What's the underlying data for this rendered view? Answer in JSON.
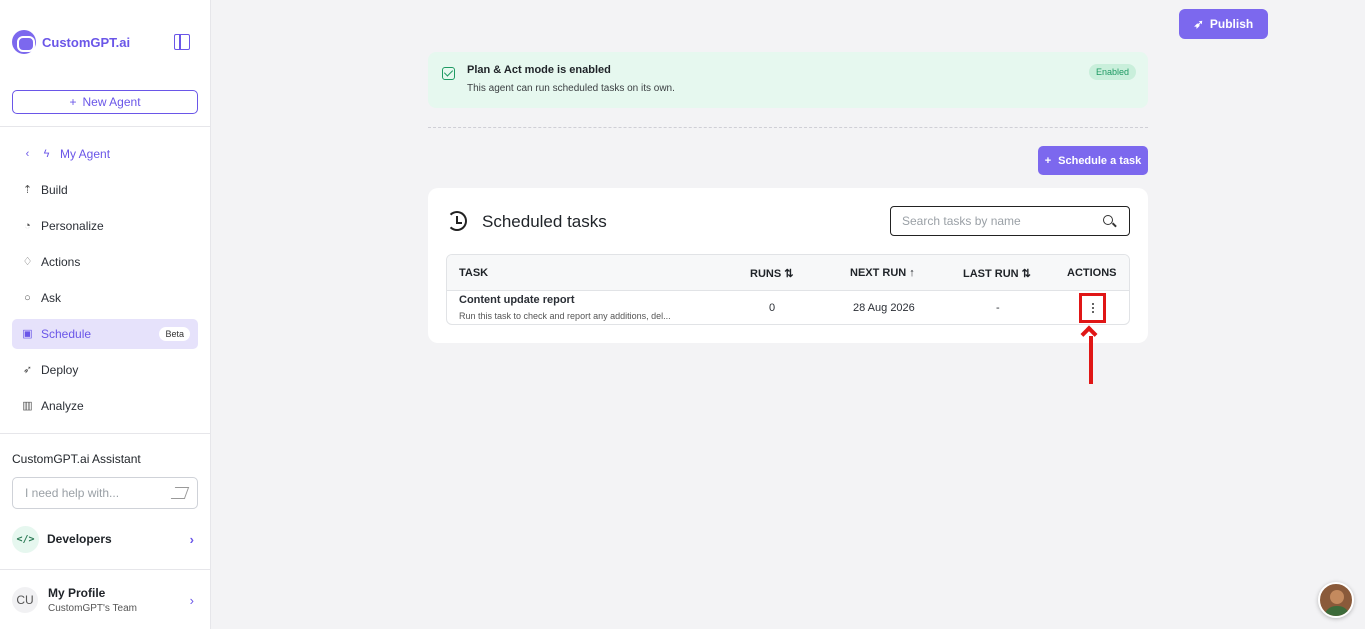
{
  "app": {
    "name": "CustomGPT.ai"
  },
  "sidebar": {
    "new_agent_label": "New Agent",
    "back_label": "My Agent",
    "items": [
      {
        "label": "Build",
        "icon": "build-icon"
      },
      {
        "label": "Personalize",
        "icon": "palette-icon"
      },
      {
        "label": "Actions",
        "icon": "actions-icon"
      },
      {
        "label": "Ask",
        "icon": "chat-icon"
      },
      {
        "label": "Schedule",
        "icon": "calendar-icon",
        "active": true,
        "badge": "Beta"
      },
      {
        "label": "Deploy",
        "icon": "rocket-icon"
      },
      {
        "label": "Analyze",
        "icon": "chart-icon"
      }
    ],
    "assistant_title": "CustomGPT.ai Assistant",
    "help_placeholder": "I need help with...",
    "developers_label": "Developers",
    "profile": {
      "initials": "CU",
      "name": "My Profile",
      "team": "CustomGPT's Team"
    }
  },
  "header": {
    "publish_label": "Publish"
  },
  "notice": {
    "title": "Plan & Act mode is enabled",
    "subtitle": "This agent can run scheduled tasks on its own.",
    "badge": "Enabled"
  },
  "schedule_button_label": "Schedule a task",
  "tasks_card": {
    "title": "Scheduled tasks",
    "search_placeholder": "Search tasks by name",
    "columns": [
      "TASK",
      "RUNS ⇅",
      "NEXT RUN ↑",
      "LAST RUN ⇅",
      "ACTIONS"
    ],
    "rows": [
      {
        "name": "Content update report",
        "description": "Run this task to check and report any additions, del...",
        "runs": "0",
        "next_run": "28 Aug 2026",
        "last_run": "-"
      }
    ]
  },
  "colors": {
    "accent": "#7c68ee",
    "highlight": "#e01616",
    "success": "#1e9a63"
  }
}
